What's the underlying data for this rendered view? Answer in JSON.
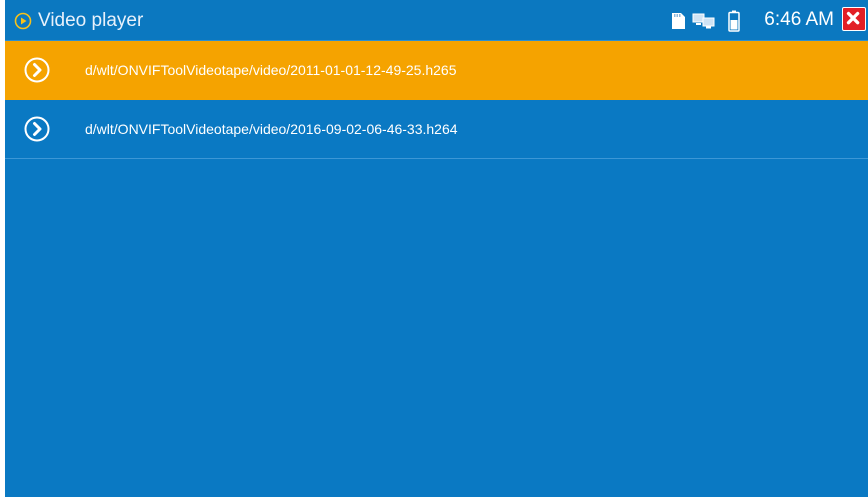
{
  "window": {
    "title": "Video player",
    "icons": {
      "app": "play-circle-icon",
      "sd": "sd-card-icon",
      "network": "network-icon",
      "battery": "battery-icon",
      "close": "close-icon"
    }
  },
  "status": {
    "time": "6:46 AM"
  },
  "files": [
    {
      "path": "d/wlt/ONVIFToolVideotape/video/2011-01-01-12-49-25.h265",
      "selected": true
    },
    {
      "path": "d/wlt/ONVIFToolVideotape/video/2016-09-02-06-46-33.h264",
      "selected": false
    }
  ],
  "colors": {
    "background": "#0a79c3",
    "selected": "#f5a300",
    "close": "#e21f26"
  }
}
